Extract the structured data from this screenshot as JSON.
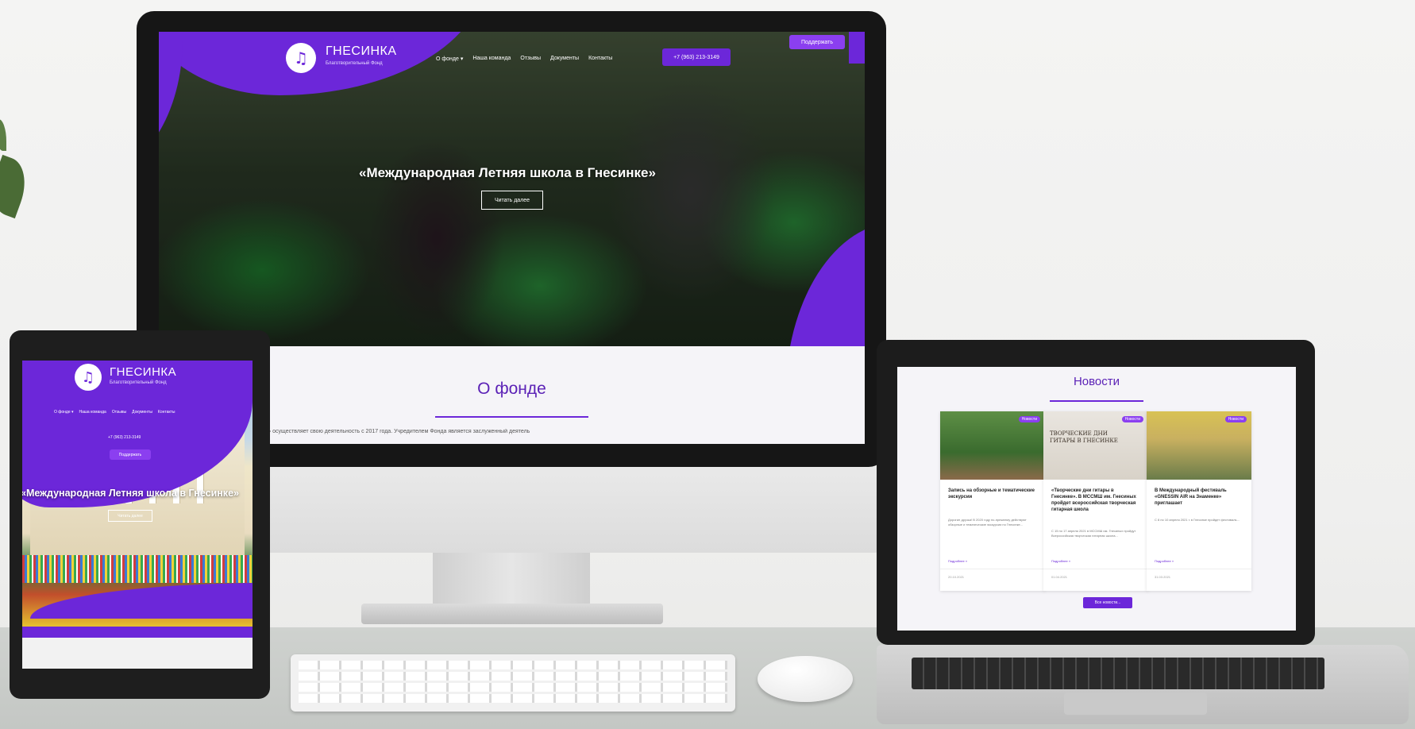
{
  "desktop": {
    "logo": {
      "name": "ГНЕСИНКА",
      "subtitle": "Благотворительный Фонд"
    },
    "nav": [
      "О фонде ▾",
      "Наша команда",
      "Отзывы",
      "Документы",
      "Контакты"
    ],
    "phone": "+7 (963) 213-3149",
    "support_label": "Поддержать",
    "hero_title": "«Международная Летняя школа в Гнесинке»",
    "read_more": "Читать далее",
    "about_title": "О фонде",
    "about_text": "Благотворительный фонд «ГНЕСИНКА» осуществляет свою деятельность с 2017 года. Учредителем Фонда является заслуженный деятель"
  },
  "tablet": {
    "logo": {
      "name": "ГНЕСИНКА",
      "subtitle": "Благотворительный Фонд"
    },
    "nav": [
      "О фонде ▾",
      "Наша команда",
      "Отзывы",
      "Документы",
      "Контакты"
    ],
    "phone": "+7 (963) 213-3149",
    "support_label": "Поддержать",
    "hero_title": "«Международная Летняя школа в Гнесинке»",
    "read_more": "Читать далее"
  },
  "laptop": {
    "news_title": "Новости",
    "badge_label": "Новости",
    "cards": [
      {
        "title": "Запись на обзорные и тематические экскурсии",
        "text": "Дорогие друзья! В 2020 году по-прежнему действуют обзорные и тематические экскурсии по Гнесинке...",
        "more": "Подробнее »",
        "date": "20.10.2021"
      },
      {
        "title": "«Творческие дни гитары в Гнесинке». В МССМШ им. Гнесиных пройдет всероссийская творческая гитарная школа",
        "text": "С 15 по 17 апреля 2021 в МССМШ им. Гнесиных пройдут Всероссийская творческая гитарная школа...",
        "more": "Подробнее »",
        "date": "01.04.2021"
      },
      {
        "title": "В Международный фестиваль «GNESSIN AIR на Знаменке» приглашает",
        "text": "С 8 по 10 апреля 2021 г. в Гнесинке пройдет фестиваль...",
        "more": "Подробнее »",
        "date": "31.03.2021"
      }
    ],
    "card2_banner": "ТВОРЧЕСКИЕ ДНИ ГИТАРЫ В ГНЕСИНКЕ",
    "all_news_label": "Все новости..."
  }
}
